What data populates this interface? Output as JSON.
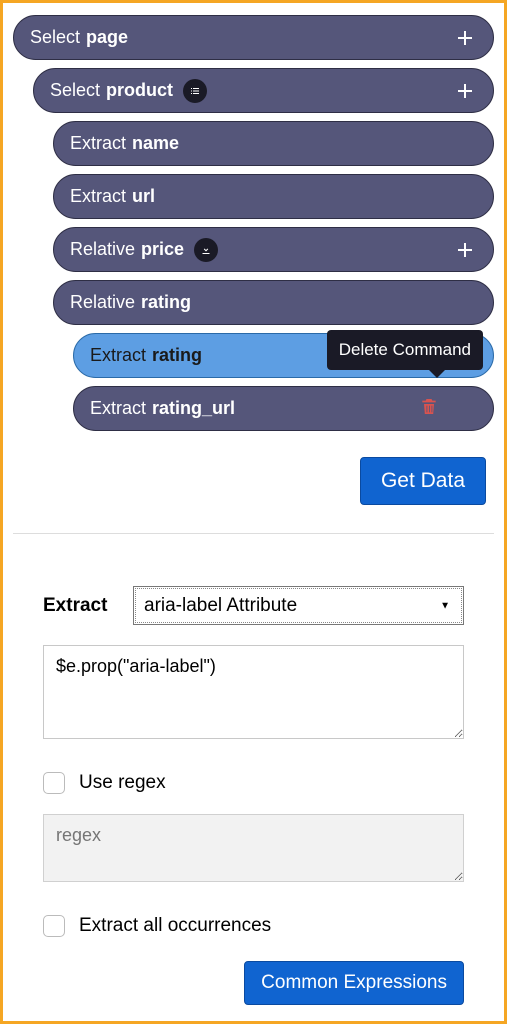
{
  "tree": {
    "n0": {
      "cmd": "Select",
      "tgt": "page"
    },
    "n1": {
      "cmd": "Select",
      "tgt": "product"
    },
    "n2": {
      "cmd": "Extract",
      "tgt": "name"
    },
    "n3": {
      "cmd": "Extract",
      "tgt": "url"
    },
    "n4": {
      "cmd": "Relative",
      "tgt": "price"
    },
    "n5": {
      "cmd": "Relative",
      "tgt": "rating"
    },
    "n6": {
      "cmd": "Extract",
      "tgt": "rating"
    },
    "n7": {
      "cmd": "Extract",
      "tgt": "rating_url"
    }
  },
  "tooltip": "Delete Command",
  "buttons": {
    "get_data": "Get Data",
    "common_expr": "Common Expressions"
  },
  "form": {
    "extract_label": "Extract",
    "dropdown_value": "aria-label Attribute",
    "code_value": "$e.prop(\"aria-label\")",
    "use_regex_label": "Use regex",
    "regex_placeholder": "regex",
    "extract_all_label": "Extract all occurrences"
  }
}
